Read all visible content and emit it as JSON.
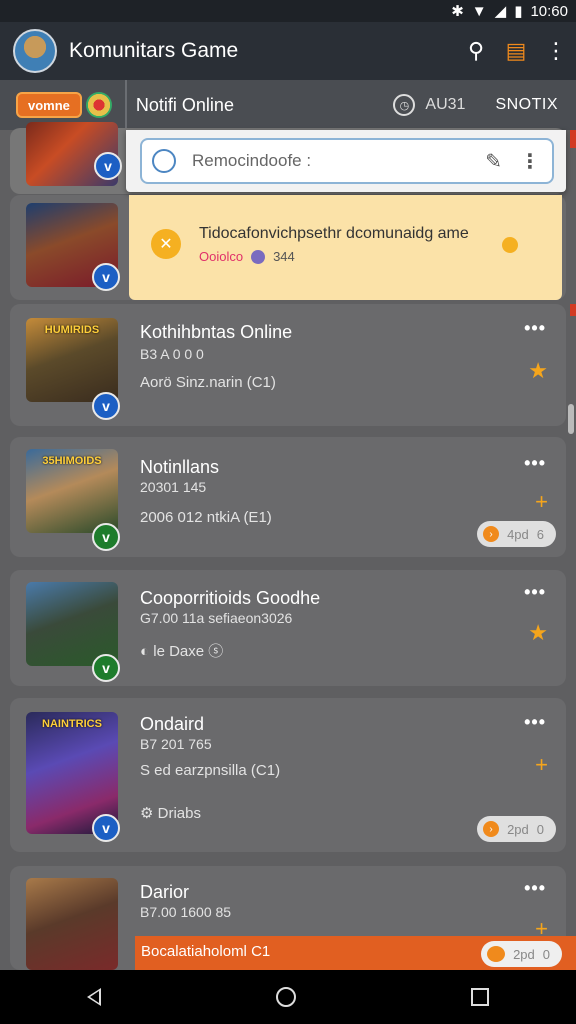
{
  "status_bar": {
    "time": "10:60",
    "icons": [
      "bluetooth-icon",
      "wifi-icon",
      "signal-icon",
      "battery-icon"
    ]
  },
  "app_bar": {
    "title": "Komunitars Game",
    "actions": [
      "search-icon",
      "list-view-icon",
      "more-vert-icon"
    ]
  },
  "sub_bar": {
    "badge": "vomne",
    "title": "Notifi Online",
    "time": "AU31",
    "right": "SNOTIX"
  },
  "search": {
    "value": "Remocindoofe :"
  },
  "notice": {
    "text": "Tidocafonvichpsethr dcomunaidg ame",
    "sub_label": "Ooiolco",
    "sub_count": "344"
  },
  "cards": [
    {
      "title": "Kothihbntas Online",
      "line1": "B3 A 0 0 0",
      "line2": "Aorö Sinz.narin",
      "line2_suffix": "(C1)",
      "thumb_caption": "HUMIRIDS",
      "verified": "v"
    },
    {
      "title": "Notinllans",
      "line1": "20301 145",
      "line2": "2006 012 ntkiA",
      "line2_suffix": "(E1)",
      "thumb_caption": "35HIMOIDS",
      "pill": "4pd",
      "pill_right": "6",
      "verified": "v"
    },
    {
      "title": "Cooporritioids Goodhe",
      "line1": "G7.00 11a sefiaeon3026",
      "meta": "le Daxe",
      "thumb_caption": "",
      "verified": "v"
    },
    {
      "title": "Ondaird",
      "line1": "B7 201 765",
      "line2": "S ed earzpnsilla",
      "line2_suffix": "(C1)",
      "meta": "Driabs",
      "thumb_caption": "NAINTRICS",
      "pill": "2pd",
      "pill_right": "0",
      "verified": "v"
    },
    {
      "title": "Darior",
      "line1": "B7.00 1600 85",
      "strip_text": "Bocalatiaholoml",
      "strip_suffix": "C1",
      "pill": "2pd",
      "pill_right": "0",
      "thumb_caption": ""
    }
  ],
  "nav": [
    "back-icon",
    "home-icon",
    "recents-icon"
  ]
}
